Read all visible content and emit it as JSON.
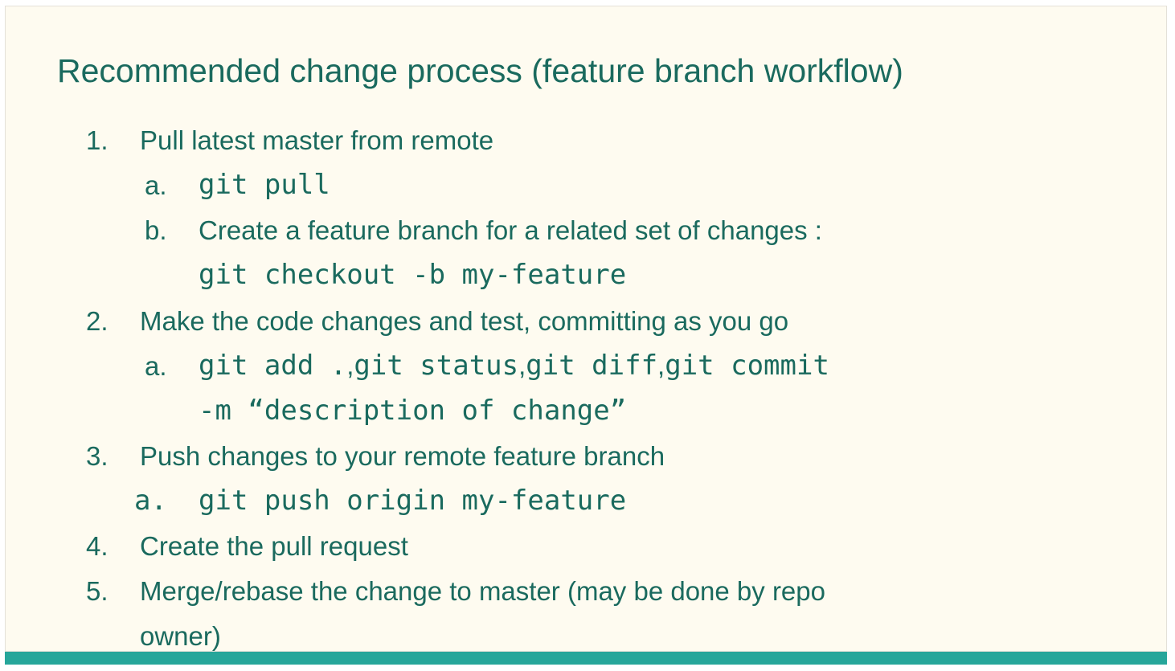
{
  "slide": {
    "title": "Recommended change process (feature branch workflow)",
    "steps": [
      {
        "number": "1.",
        "text": "Pull latest master from remote",
        "subs": [
          {
            "marker": "a.",
            "code": "git pull"
          },
          {
            "marker": "b.",
            "text": "Create a feature branch for a related set of changes :",
            "code": "git checkout -b my-feature"
          }
        ]
      },
      {
        "number": "2.",
        "text": "Make the code changes and test, committing as you go",
        "subs": [
          {
            "marker": "a.",
            "code_parts": [
              "git add .",
              ",",
              "git status",
              ",",
              "git diff",
              ",",
              "git commit"
            ],
            "code_continued": "-m “description of change”"
          }
        ]
      },
      {
        "number": "3.",
        "text": "Push changes to your remote feature branch",
        "subs": [
          {
            "marker": "a.",
            "code": "git push origin my-feature"
          }
        ]
      },
      {
        "number": "4.",
        "text": "Create the pull request"
      },
      {
        "number": "5.",
        "text": "Merge/rebase the change to master (may be done by repo",
        "text_continued": "owner)"
      }
    ]
  },
  "colors": {
    "text": "#1a6a5e",
    "background": "#fefbf0",
    "accent_bar": "#26a69a"
  }
}
